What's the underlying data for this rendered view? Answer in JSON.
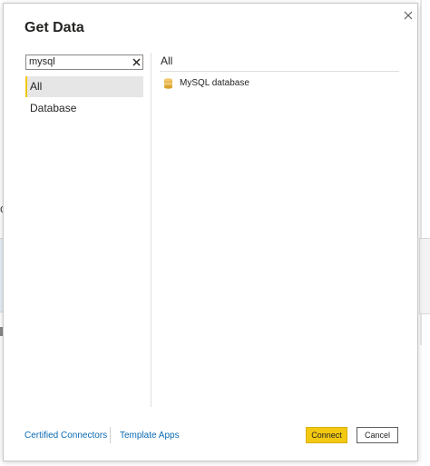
{
  "dialog": {
    "title": "Get Data",
    "close_icon": "close-icon"
  },
  "search": {
    "value": "mysql",
    "placeholder": "",
    "clear_icon": "clear-icon"
  },
  "categories": [
    {
      "label": "All",
      "selected": true
    },
    {
      "label": "Database",
      "selected": false
    }
  ],
  "results": {
    "header": "All",
    "items": [
      {
        "label": "MySQL database",
        "icon": "database-cylinder-icon"
      }
    ]
  },
  "footer": {
    "certified_connectors": "Certified Connectors",
    "template_apps": "Template Apps",
    "connect_label": "Connect",
    "cancel_label": "Cancel"
  },
  "colors": {
    "accent": "#f2c811",
    "link": "#0b6ab3",
    "selected_bg": "#e6e6e6",
    "database_icon": "#e8b54a"
  }
}
